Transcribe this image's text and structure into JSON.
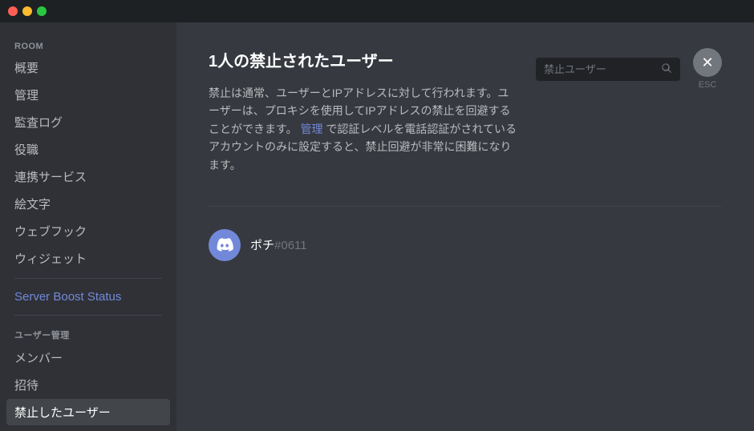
{
  "titlebar": {
    "controls": [
      "close",
      "minimize",
      "maximize"
    ]
  },
  "sidebar": {
    "room_section_label": "ROOM",
    "items": [
      {
        "id": "overview",
        "label": "概要",
        "active": false,
        "accent": false
      },
      {
        "id": "management",
        "label": "管理",
        "active": false,
        "accent": false
      },
      {
        "id": "audit-log",
        "label": "監査ログ",
        "active": false,
        "accent": false
      },
      {
        "id": "roles",
        "label": "役職",
        "active": false,
        "accent": false
      },
      {
        "id": "integrations",
        "label": "連携サービス",
        "active": false,
        "accent": false
      },
      {
        "id": "emoji",
        "label": "絵文字",
        "active": false,
        "accent": false
      },
      {
        "id": "webhooks",
        "label": "ウェブフック",
        "active": false,
        "accent": false
      },
      {
        "id": "widget",
        "label": "ウィジェット",
        "active": false,
        "accent": false
      }
    ],
    "server_boost_label": "Server Boost Status",
    "user_management_section_label": "ユーザー管理",
    "user_management_items": [
      {
        "id": "members",
        "label": "メンバー",
        "active": false
      },
      {
        "id": "invites",
        "label": "招待",
        "active": false
      },
      {
        "id": "banned-users",
        "label": "禁止したユーザー",
        "active": true
      }
    ]
  },
  "main": {
    "page_title": "1人の禁止されたユーザー",
    "description_part1": "禁止は通常、ユーザーとIPアドレスに対して行われます。ユーザーは、プロキシを使用してIPアドレスの禁止を回避することができます。",
    "description_link": "管理",
    "description_part2": "で認証レベルを電話認証がされているアカウントのみに設定すると、禁止回避が非常に困難になります。",
    "search_placeholder": "禁止ユーザー",
    "close_button_label": "×",
    "esc_label": "ESC",
    "divider": true,
    "banned_users": [
      {
        "id": "pochi",
        "name": "ポチ",
        "discriminator": "#0611"
      }
    ]
  }
}
